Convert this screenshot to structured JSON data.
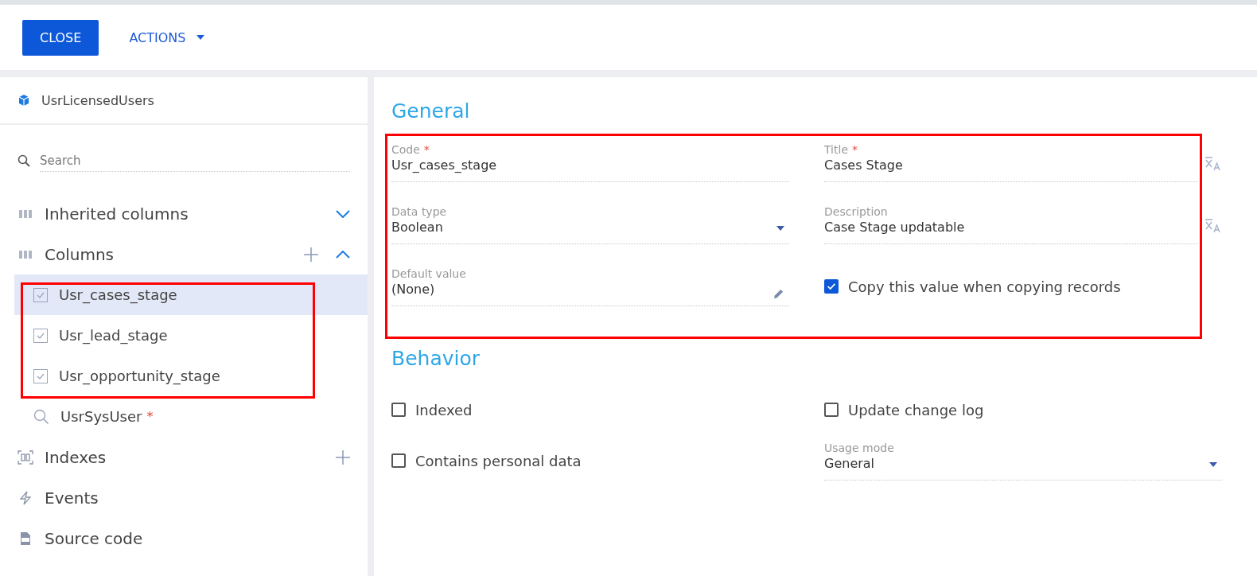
{
  "toolbar": {
    "close_button": "CLOSE",
    "actions_menu": "ACTIONS"
  },
  "object": {
    "name": "UsrLicensedUsers"
  },
  "search": {
    "placeholder": "Search"
  },
  "sections": [
    {
      "label": "Inherited columns",
      "kind": "columns",
      "expanded": false,
      "can_add": false
    },
    {
      "label": "Columns",
      "kind": "columns",
      "expanded": true,
      "can_add": true,
      "items": [
        {
          "name": "Usr_cases_stage",
          "kind": "boolean",
          "selected": true
        },
        {
          "name": "Usr_lead_stage",
          "kind": "boolean",
          "selected": false
        },
        {
          "name": "Usr_opportunity_stage",
          "kind": "boolean",
          "selected": false
        },
        {
          "name": "UsrSysUser",
          "kind": "lookup",
          "selected": false,
          "required_mark": "*"
        }
      ]
    },
    {
      "label": "Indexes",
      "kind": "indexes",
      "can_add": true
    },
    {
      "label": "Events",
      "kind": "events",
      "can_add": false
    },
    {
      "label": "Source code",
      "kind": "source",
      "can_add": false
    }
  ],
  "general": {
    "title": "General",
    "rows": [
      [
        {
          "kind": "text",
          "label": "Code",
          "value": "Usr_cases_stage",
          "required_mark": "*"
        },
        {
          "kind": "translatable",
          "label": "Title",
          "value": "Cases Stage",
          "required_mark": "*"
        }
      ],
      [
        {
          "kind": "dropdown",
          "label": "Data type",
          "value": "Boolean"
        },
        {
          "kind": "translatable",
          "label": "Description",
          "value": "Case Stage updatable"
        }
      ],
      [
        {
          "kind": "editable",
          "label": "Default value",
          "value": "(None)"
        },
        {
          "kind": "checkbox",
          "label": "Copy this value when copying records",
          "checked": true
        }
      ]
    ]
  },
  "behavior": {
    "title": "Behavior",
    "rows": [
      [
        {
          "kind": "checkbox",
          "label": "Indexed",
          "checked": false
        },
        {
          "kind": "checkbox",
          "label": "Update change log",
          "checked": false
        }
      ],
      [
        {
          "kind": "checkbox",
          "label": "Contains personal data",
          "checked": false
        },
        {
          "kind": "dropdown",
          "label": "Usage mode",
          "value": "General"
        }
      ]
    ]
  }
}
